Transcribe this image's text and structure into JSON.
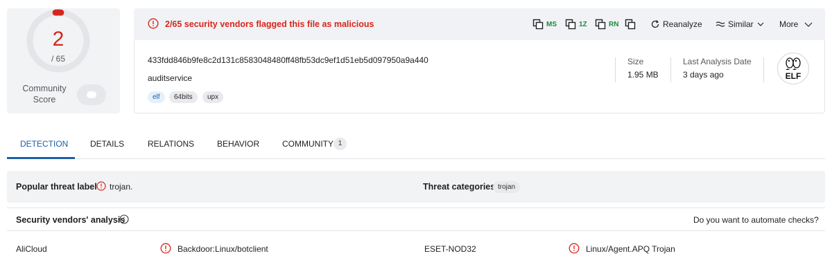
{
  "score": {
    "detected": "2",
    "total": "/ 65",
    "detected_fraction": 0.03,
    "community_label": "Community Score"
  },
  "banner": {
    "alert": "2/65 security vendors flagged this file as malicious"
  },
  "toolbar": {
    "copy_ms": "MS",
    "copy_1z": "1Z",
    "copy_rn": "RN",
    "reanalyze": "Reanalyze",
    "similar": "Similar",
    "more": "More"
  },
  "file": {
    "hash": "433fdd846b9fe8c2d131c8583048480ff48fb53dc9ef1d51eb5d097950a9a440",
    "name": "auditservice",
    "tags": [
      "elf",
      "64bits",
      "upx"
    ],
    "size_label": "Size",
    "size_value": "1.95 MB",
    "date_label": "Last Analysis Date",
    "date_value": "3 days ago",
    "type_badge": "ELF"
  },
  "tabs": {
    "detection": "DETECTION",
    "details": "DETAILS",
    "relations": "RELATIONS",
    "behavior": "BEHAVIOR",
    "community": "COMMUNITY",
    "community_count": "1"
  },
  "threat": {
    "popular_label": "Popular threat label",
    "popular_value": "trojan.",
    "categories_label": "Threat categories",
    "categories_value": "trojan"
  },
  "vendors": {
    "heading": "Security vendors' analysis",
    "automate": "Do you want to automate checks?",
    "rows": [
      {
        "vendor_a": "AliCloud",
        "result_a": "Backdoor:Linux/botclient",
        "vendor_b": "ESET-NOD32",
        "result_b": "Linux/Agent.APQ Trojan"
      }
    ]
  },
  "colors": {
    "malicious": "#d6261c",
    "accent": "#1b5fa8",
    "tag_green": "#1b8a3b"
  }
}
